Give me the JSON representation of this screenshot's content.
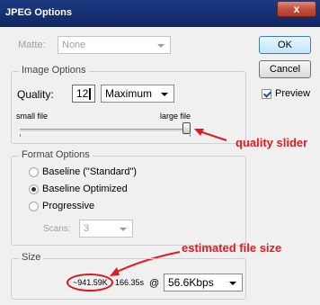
{
  "window": {
    "title": "JPEG Options",
    "close_glyph": "x"
  },
  "matte": {
    "label": "Matte:",
    "value": "None"
  },
  "buttons": {
    "ok": "OK",
    "cancel": "Cancel"
  },
  "preview": {
    "label": "Preview",
    "checked": true
  },
  "image_options": {
    "title": "Image Options",
    "quality_label": "Quality:",
    "quality_value": "12",
    "quality_preset": "Maximum",
    "small_file_label": "small file",
    "large_file_label": "large file",
    "slider_level_percent": 100
  },
  "format_options": {
    "title": "Format Options",
    "options": [
      {
        "label": "Baseline (\"Standard\")",
        "selected": false
      },
      {
        "label": "Baseline Optimized",
        "selected": true
      },
      {
        "label": "Progressive",
        "selected": false
      }
    ],
    "scans_label": "Scans:",
    "scans_value": "3"
  },
  "size": {
    "title": "Size",
    "file_size": "~941.59K",
    "download_time": "166.35s",
    "at_symbol": "@",
    "connection_speed": "56.6Kbps"
  },
  "annotations": {
    "quality_slider": "quality slider",
    "estimated_size": "estimated file size",
    "color": "#e6191e"
  }
}
